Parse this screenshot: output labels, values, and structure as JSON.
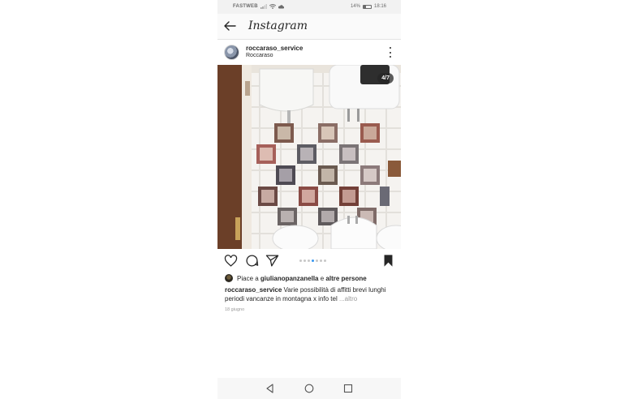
{
  "status_bar": {
    "carrier": "FASTWEB",
    "battery": "14%",
    "time": "18:16"
  },
  "app_header": {
    "title": "Instagram"
  },
  "post": {
    "username": "roccaraso_service",
    "location": "Roccaraso",
    "slide_counter": "4/7",
    "carousel": {
      "total": 7,
      "current": 4
    },
    "likes": {
      "prefix": "Piace a",
      "user": "giulianopanzanella",
      "joiner": "e",
      "others": "altre persone"
    },
    "caption": {
      "username": "roccaraso_service",
      "text": "Varie possibilità di affitti brevi lunghi periodi vancanze in montagna x info tel",
      "more": "...altro"
    },
    "date": "18 giugno"
  },
  "icons": {
    "back": "arrow-left-icon",
    "more": "more-vertical-icon",
    "like": "heart-icon",
    "comment": "comment-icon",
    "share": "send-icon",
    "save": "bookmark-icon",
    "nav_back": "triangle-back-icon",
    "nav_home": "circle-home-icon",
    "nav_recent": "square-recent-icon"
  },
  "colors": {
    "accent": "#3897f0",
    "text": "#262626",
    "muted": "#999999"
  }
}
